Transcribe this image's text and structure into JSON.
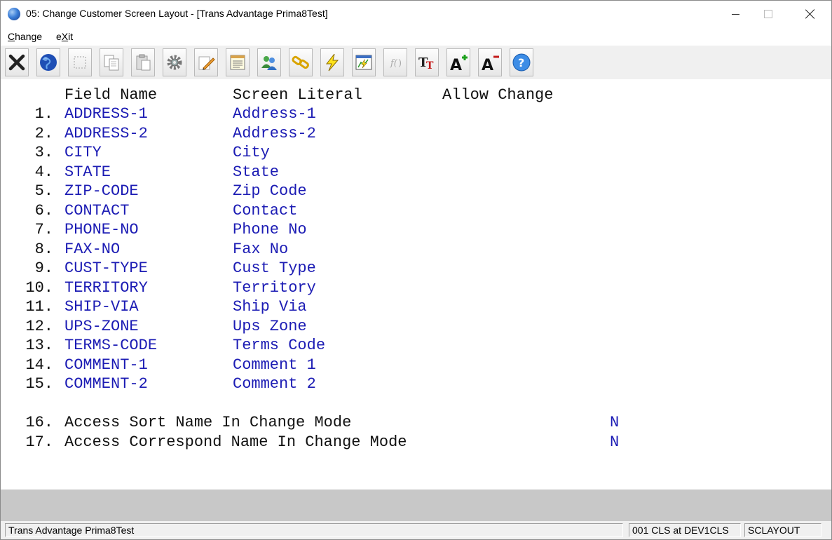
{
  "window": {
    "title": "05: Change Customer Screen Layout - [Trans Advantage  Prima8Test]"
  },
  "menu": {
    "change": {
      "first": "C",
      "rest": "hange"
    },
    "exit": {
      "first": "e",
      "underlined": "X",
      "rest": "it"
    }
  },
  "toolbar": {
    "icons": [
      "exit-x-icon",
      "globe-icon",
      "blank-icon",
      "copy-icon",
      "paste-icon",
      "gear-icon",
      "edit-pencil-icon",
      "notepad-icon",
      "users-icon",
      "chain-link-icon",
      "lightning-icon",
      "chart-window-icon",
      "function-icon",
      "font-tt-icon",
      "font-increase-icon",
      "font-decrease-icon",
      "help-icon"
    ]
  },
  "columns": {
    "field_name": "Field Name",
    "screen_literal": "Screen Literal",
    "allow_change": "Allow Change"
  },
  "rows": [
    {
      "num": "1.",
      "field": "ADDRESS-1",
      "literal": "Address-1"
    },
    {
      "num": "2.",
      "field": "ADDRESS-2",
      "literal": "Address-2"
    },
    {
      "num": "3.",
      "field": "CITY",
      "literal": "City"
    },
    {
      "num": "4.",
      "field": "STATE",
      "literal": "State"
    },
    {
      "num": "5.",
      "field": "ZIP-CODE",
      "literal": "Zip Code"
    },
    {
      "num": "6.",
      "field": "CONTACT",
      "literal": "Contact"
    },
    {
      "num": "7.",
      "field": "PHONE-NO",
      "literal": "Phone No"
    },
    {
      "num": "8.",
      "field": "FAX-NO",
      "literal": "Fax No"
    },
    {
      "num": "9.",
      "field": "CUST-TYPE",
      "literal": "Cust Type"
    },
    {
      "num": "10.",
      "field": "TERRITORY",
      "literal": "Territory"
    },
    {
      "num": "11.",
      "field": "SHIP-VIA",
      "literal": "Ship Via"
    },
    {
      "num": "12.",
      "field": "UPS-ZONE",
      "literal": "Ups Zone"
    },
    {
      "num": "13.",
      "field": "TERMS-CODE",
      "literal": "Terms Code"
    },
    {
      "num": "14.",
      "field": "COMMENT-1",
      "literal": "Comment 1"
    },
    {
      "num": "15.",
      "field": "COMMENT-2",
      "literal": "Comment 2"
    }
  ],
  "options": [
    {
      "num": "16.",
      "label": "Access Sort Name In Change Mode",
      "value": "N"
    },
    {
      "num": "17.",
      "label": "Access Correspond Name In Change Mode",
      "value": "N"
    }
  ],
  "status": {
    "company": "Trans Advantage  Prima8Test",
    "session": "001 CLS at DEV1CLS",
    "program": "SCLAYOUT"
  },
  "colors": {
    "field_blue": "#1c1cb4",
    "gray_strip": "#c8c8c8"
  }
}
